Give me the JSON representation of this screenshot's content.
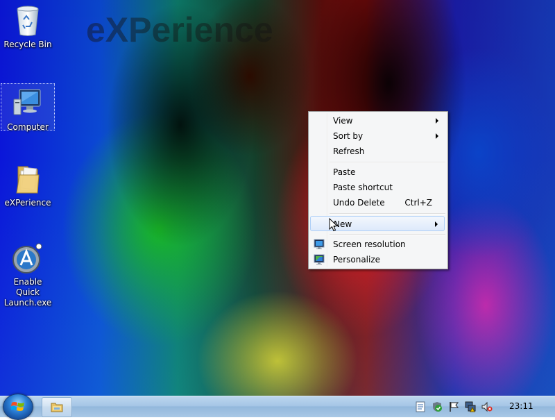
{
  "desktop": {
    "watermark": "eXPerience",
    "icons": [
      {
        "label": "Recycle Bin",
        "icon": "recycle-bin-icon"
      },
      {
        "label": "Computer",
        "icon": "computer-icon",
        "selected": true
      },
      {
        "label": "eXPerience",
        "icon": "folder-icon"
      },
      {
        "label": "Enable Quick Launch.exe",
        "icon": "quick-launch-app-icon"
      }
    ]
  },
  "context_menu": {
    "items": [
      {
        "label": "View",
        "submenu": true
      },
      {
        "label": "Sort by",
        "submenu": true
      },
      {
        "label": "Refresh"
      },
      {
        "label": "Paste"
      },
      {
        "label": "Paste shortcut"
      },
      {
        "label": "Undo Delete",
        "shortcut": "Ctrl+Z"
      },
      {
        "label": "New",
        "submenu": true,
        "highlighted": true
      },
      {
        "label": "Screen resolution",
        "icon": "screen-resolution-icon"
      },
      {
        "label": "Personalize",
        "icon": "personalize-icon"
      }
    ]
  },
  "taskbar": {
    "start_icon": "windows-logo-icon",
    "pinned": [
      {
        "icon": "windows-explorer-icon"
      }
    ],
    "tray": [
      "notes-icon",
      "security-shield-icon",
      "action-center-flag-icon",
      "network-warning-icon",
      "volume-muted-icon"
    ],
    "clock": "23:11"
  },
  "colors": {
    "menu_background": "#f5f6f7",
    "menu_highlight": "#dde9fb",
    "taskbar": "#a6c6e6"
  }
}
